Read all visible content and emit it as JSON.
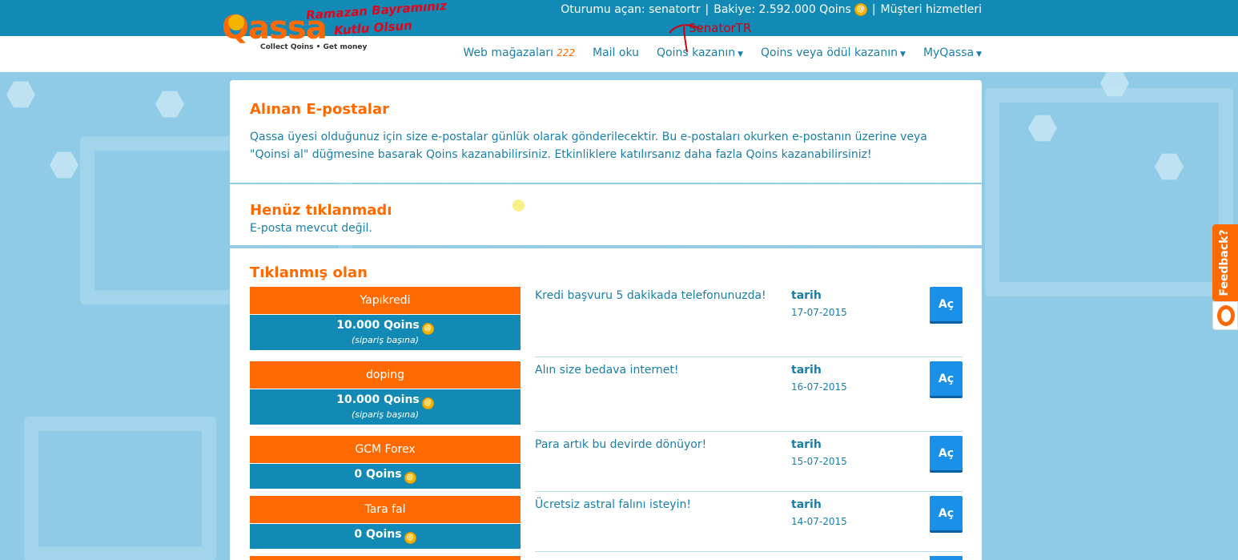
{
  "header": {
    "logo_text": "Qassa",
    "logo_tagline": "Collect Qoins • Get money",
    "banner_line1": "Ramazan Bayramınız",
    "banner_line2": "Kutlu Olsun",
    "session_label": "Oturumu açan: senatortr",
    "balance_label": "Bakiye: 2.592.000 Qoins",
    "customer_service": "Müşteri hizmetleri",
    "separator": "|",
    "annotation": "SenatorTR"
  },
  "nav": {
    "items": [
      {
        "label": "Web mağazaları",
        "count": "222"
      },
      {
        "label": "Mail oku"
      },
      {
        "label": "Qoins kazanın",
        "caret": "▼"
      },
      {
        "label": "Qoins veya ödül kazanın",
        "caret": "▼"
      },
      {
        "label": "MyQassa",
        "caret": "▼"
      }
    ]
  },
  "received": {
    "title": "Alınan E-postalar",
    "description": "Qassa üyesi olduğunuz için size e-postalar günlük olarak gönderilecektir. Bu e-postaları okurken e-postanın üzerine veya \"Qoinsi al\" düğmesine basarak Qoins kazanabilirsiniz. Etkinliklere katılırsanız daha fazla Qoins kazanabilirsiniz!"
  },
  "unclicked": {
    "title": "Henüz tıklanmadı",
    "empty": "E-posta mevcut değil."
  },
  "clicked": {
    "title": "Tıklanmış olan",
    "date_label": "tarih",
    "open_label": "Aç",
    "rows": [
      {
        "merchant": "Yapıkredi",
        "qoins": "10.000 Qoins",
        "per": "(sipariş başına)",
        "subject": "Kredi başvuru 5 dakikada telefonunuzda!",
        "date": "17-07-2015"
      },
      {
        "merchant": "doping",
        "qoins": "10.000 Qoins",
        "per": "(sipariş başına)",
        "subject": "Alın size bedava internet!",
        "date": "16-07-2015"
      },
      {
        "merchant": "GCM Forex",
        "qoins": "0 Qoins",
        "per": "",
        "subject": "Para artık bu devirde dönüyor!",
        "date": "15-07-2015"
      },
      {
        "merchant": "Tara fal",
        "qoins": "0 Qoins",
        "per": "",
        "subject": "Ücretsiz astral falını isteyin!",
        "date": "14-07-2015"
      }
    ]
  },
  "feedback": {
    "label": "Feedback?"
  },
  "colors": {
    "orange": "#ff6a00",
    "blue": "#128ab5",
    "button_blue": "#1a90e8"
  }
}
